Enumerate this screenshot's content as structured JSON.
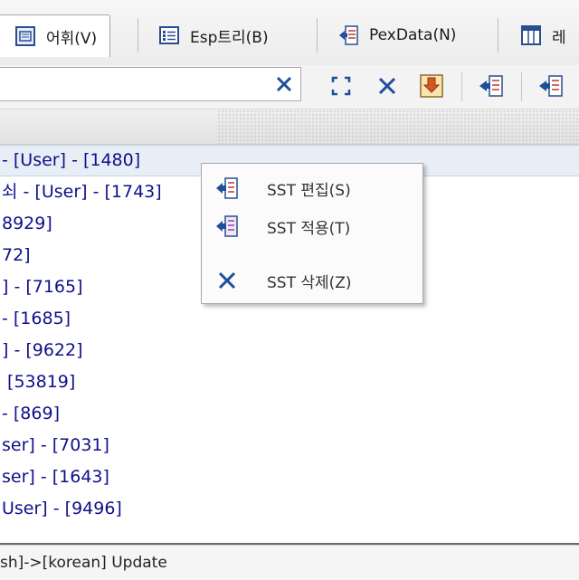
{
  "toolbar": {
    "tabs": [
      {
        "label": "어휘(V)"
      },
      {
        "label": "Esp트리(B)"
      },
      {
        "label": "PexData(N)"
      },
      {
        "label": "레"
      }
    ]
  },
  "search": {
    "value": "",
    "clear_icon": "close-icon"
  },
  "list": {
    "rows": [
      "- [User] - [1480]",
      "쇠 - [User] - [1743]",
      "8929]",
      "72]",
      "] - [7165]",
      "- [1685]",
      "] - [9622]",
      " [53819]",
      "- [869]",
      "ser] - [7031]",
      "ser] - [1643]",
      "User] - [9496]"
    ]
  },
  "context_menu": {
    "items": [
      {
        "label": "SST 편집(S)"
      },
      {
        "label": "SST 적용(T)"
      },
      {
        "label": "SST 삭제(Z)"
      }
    ]
  },
  "status": {
    "text": "sh]->[korean] Update"
  },
  "colors": {
    "accent": "#1f4f9a",
    "list_text": "#10108a",
    "selection": "#e8eef6"
  }
}
